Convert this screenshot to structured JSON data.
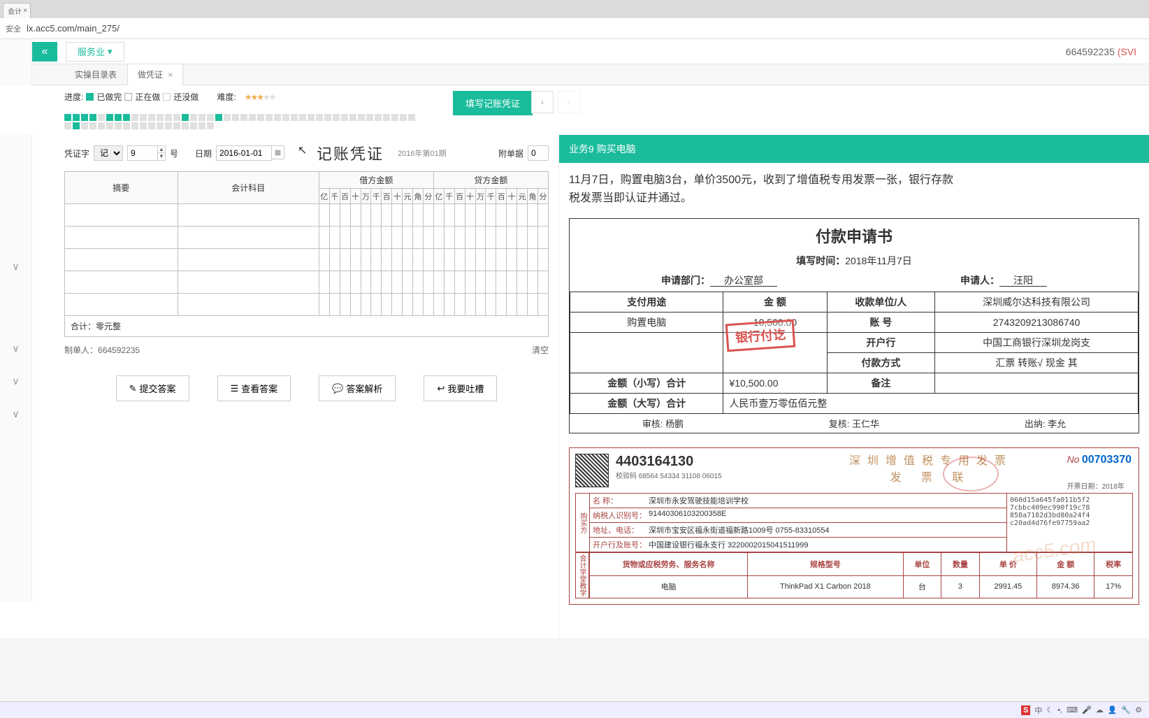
{
  "browser": {
    "tab_label": "会计",
    "security_label": "安全",
    "url": "lx.acc5.com/main_275/"
  },
  "header": {
    "service_label": "服务业",
    "user_id": "664592235",
    "user_level": "(SVI"
  },
  "tabs": {
    "list_tab": "实操目录表",
    "voucher_tab": "做凭证"
  },
  "progress": {
    "label_progress": "进度:",
    "label_done": "已做完",
    "label_doing": "正在做",
    "label_todo": "还没做",
    "label_difficulty": "难度:",
    "fill_button": "填写记账凭证"
  },
  "voucher": {
    "type_label": "凭证字",
    "type_value": "记",
    "number_value": "9",
    "number_suffix": "号",
    "date_label": "日期",
    "date_value": "2016-01-01",
    "title": "记账凭证",
    "period": "2016年第01期",
    "attach_label": "附单据",
    "attach_value": "0",
    "col_summary": "摘要",
    "col_subject": "会计科目",
    "col_debit": "借方金额",
    "col_credit": "贷方金额",
    "units": [
      "亿",
      "千",
      "百",
      "十",
      "万",
      "千",
      "百",
      "十",
      "元",
      "角",
      "分"
    ],
    "total_label": "合计：零元整",
    "maker_label": "制单人：",
    "maker_value": "664592235",
    "clear_label": "清空"
  },
  "buttons": {
    "submit": "提交答案",
    "view": "查看答案",
    "analysis": "答案解析",
    "feedback": "我要吐槽"
  },
  "doc": {
    "header": "业务9 购买电脑",
    "description": "11月7日，购置电脑3台，单价3500元，收到了增值税专用发票一张，银行存款\n税发票当即认证并通过。"
  },
  "payform": {
    "title": "付款申请书",
    "fill_time_label": "填写时间：",
    "fill_time_value": "2018年11月7日",
    "dept_label": "申请部门：",
    "dept_value": "办公室部",
    "applicant_label": "申请人：",
    "applicant_value": "汪阳",
    "h_purpose": "支付用途",
    "h_amount": "金 额",
    "h_payee": "收款单位/人",
    "purpose_value": "购置电脑",
    "amount_value": "10,500.00",
    "payee_value": "深圳威尔达科技有限公司",
    "acct_label": "账 号",
    "acct_value": "2743209213086740",
    "bank_label": "开户行",
    "bank_value": "中国工商银行深圳龙岗支",
    "method_label": "付款方式",
    "method_value": "汇票 转账√ 现金 其",
    "sum_small_label": "金额（小写）合计",
    "sum_small_value": "¥10,500.00",
    "remark_label": "备注",
    "sum_big_label": "金额（大写）合计",
    "sum_big_value": "人民币壹万零伍佰元整",
    "auditor_label": "审核: 杨鹏",
    "reviewer_label": "复核: 王仁华",
    "cashier_label": "出纳: 李允",
    "stamp": "银行付讫"
  },
  "invoice": {
    "code": "4403164130",
    "check_prefix": "校验码",
    "check_value": "68564 54334 31108 06015",
    "title_line1": "深圳增值税专用发票",
    "title_line2": "发 票 联",
    "no_prefix": "No",
    "no_value": "00703370",
    "issue_prefix": "开票日期：",
    "issue_value": "2018年",
    "buyer_label": "购买方",
    "k_name": "名        称：",
    "v_name": "深圳市永安驾驶技能培训学校",
    "k_tax": "纳税人识别号：",
    "v_tax": "91440306103200358E",
    "k_addr": "地址、电话：",
    "v_addr": "深圳市宝安区福永街道福新路1009号 0755-83310554",
    "k_bank": "开户行及账号：",
    "v_bank": "中国建设银行福永支行 3220002015041511999",
    "crypt": "060d15a645fa011b5f2\n7cbbc409ec990f19c78\n858a7182d3bd80a24f4\nc20ad4d76fe97759aa2",
    "side_label": "会计学堂教学",
    "th_goods": "货物或应税劳务、服务名称",
    "th_spec": "规格型号",
    "th_unit": "单位",
    "th_qty": "数量",
    "th_price": "单 价",
    "th_amount": "金 额",
    "th_rate": "税率",
    "td_goods": "电脑",
    "td_spec": "ThinkPad X1 Carbon 2018",
    "td_unit": "台",
    "td_qty": "3",
    "td_price": "2991.45",
    "td_amount": "8974.36",
    "td_rate": "17%",
    "watermark": "acc5.com"
  }
}
